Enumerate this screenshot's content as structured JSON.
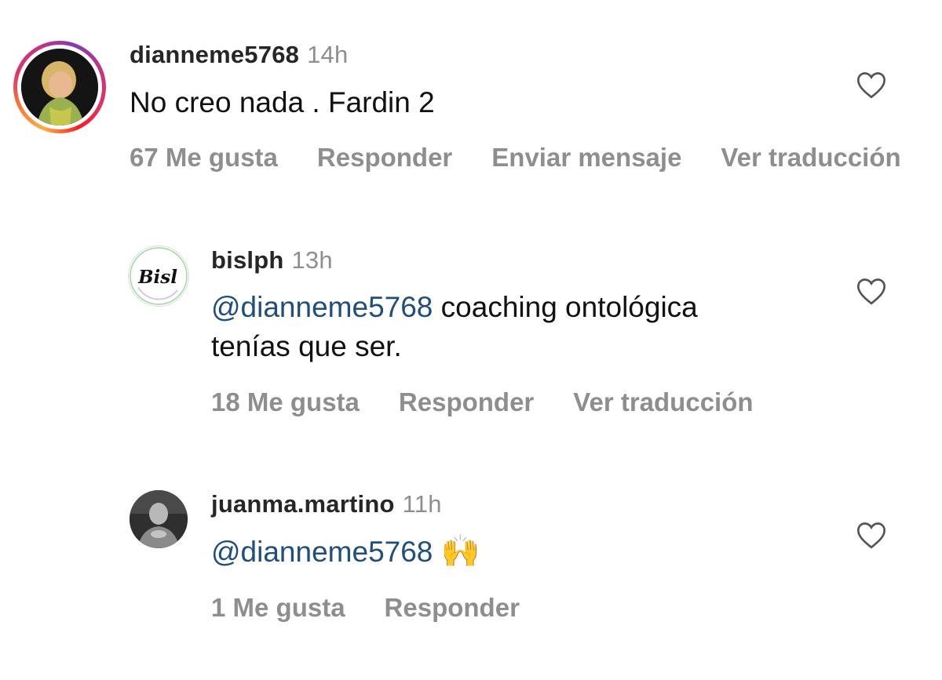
{
  "comments": [
    {
      "username": "dianneme5768",
      "time": "14h",
      "text": "No creo nada . Fardin 2",
      "likes": "67 Me gusta",
      "reply": "Responder",
      "send": "Enviar mensaje",
      "translate": "Ver traducción"
    },
    {
      "username": "bislph",
      "time": "13h",
      "mention": "@dianneme5768",
      "text_line1": " coaching ontológica",
      "text_line2": "tenías que ser.",
      "avatar_logo": "Bisl",
      "likes": "18 Me gusta",
      "reply": "Responder",
      "translate": "Ver traducción"
    },
    {
      "username": "juanma.martino",
      "time": "11h",
      "mention": "@dianneme5768",
      "emoji": "🙌",
      "likes": "1 Me gusta",
      "reply": "Responder"
    }
  ],
  "icons": {
    "like": "heart-outline-icon",
    "emoji": "raising-hands-emoji"
  }
}
